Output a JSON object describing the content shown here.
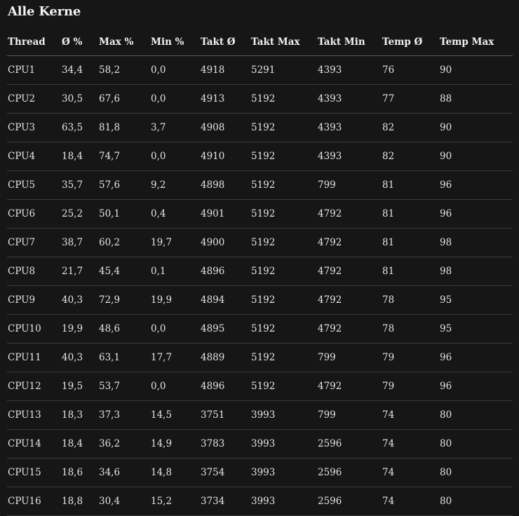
{
  "title": "Alle Kerne",
  "columns": [
    "Thread",
    "Ø %",
    "Max %",
    "Min %",
    "Takt Ø",
    "Takt Max",
    "Takt Min",
    "Temp Ø",
    "Temp Max"
  ],
  "rows": [
    [
      "CPU1",
      "34,4",
      "58,2",
      "0,0",
      "4918",
      "5291",
      "4393",
      "76",
      "90"
    ],
    [
      "CPU2",
      "30,5",
      "67,6",
      "0,0",
      "4913",
      "5192",
      "4393",
      "77",
      "88"
    ],
    [
      "CPU3",
      "63,5",
      "81,8",
      "3,7",
      "4908",
      "5192",
      "4393",
      "82",
      "90"
    ],
    [
      "CPU4",
      "18,4",
      "74,7",
      "0,0",
      "4910",
      "5192",
      "4393",
      "82",
      "90"
    ],
    [
      "CPU5",
      "35,7",
      "57,6",
      "9,2",
      "4898",
      "5192",
      "799",
      "81",
      "96"
    ],
    [
      "CPU6",
      "25,2",
      "50,1",
      "0,4",
      "4901",
      "5192",
      "4792",
      "81",
      "96"
    ],
    [
      "CPU7",
      "38,7",
      "60,2",
      "19,7",
      "4900",
      "5192",
      "4792",
      "81",
      "98"
    ],
    [
      "CPU8",
      "21,7",
      "45,4",
      "0,1",
      "4896",
      "5192",
      "4792",
      "81",
      "98"
    ],
    [
      "CPU9",
      "40,3",
      "72,9",
      "19,9",
      "4894",
      "5192",
      "4792",
      "78",
      "95"
    ],
    [
      "CPU10",
      "19,9",
      "48,6",
      "0,0",
      "4895",
      "5192",
      "4792",
      "78",
      "95"
    ],
    [
      "CPU11",
      "40,3",
      "63,1",
      "17,7",
      "4889",
      "5192",
      "799",
      "79",
      "96"
    ],
    [
      "CPU12",
      "19,5",
      "53,7",
      "0,0",
      "4896",
      "5192",
      "4792",
      "79",
      "96"
    ],
    [
      "CPU13",
      "18,3",
      "37,3",
      "14,5",
      "3751",
      "3993",
      "799",
      "74",
      "80"
    ],
    [
      "CPU14",
      "18,4",
      "36,2",
      "14,9",
      "3783",
      "3993",
      "2596",
      "74",
      "80"
    ],
    [
      "CPU15",
      "18,6",
      "34,6",
      "14,8",
      "3754",
      "3993",
      "2596",
      "74",
      "80"
    ],
    [
      "CPU16",
      "18,8",
      "30,4",
      "15,2",
      "3734",
      "3993",
      "2596",
      "74",
      "80"
    ]
  ]
}
